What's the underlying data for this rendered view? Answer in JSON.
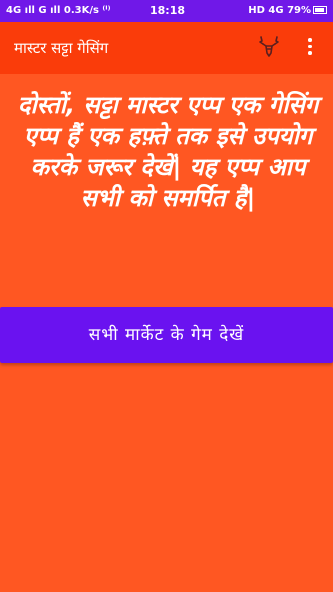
{
  "status_bar": {
    "left": "4G ıll G ıll 0.3K/s ⁽ᴵ⁾",
    "time": "18:18",
    "right": "HD 4G 79%"
  },
  "app_bar": {
    "title": "मास्टर सट्टा गेसिंग",
    "icon": "deer-head-icon",
    "menu_icon": "overflow-menu-icon"
  },
  "main": {
    "intro_text": "दोस्तों, सट्टा मास्टर एप्प एक गेसिंग एप्प हैं एक हफ़्ते तक इसे उपयोग करके जरूर देखें| यह एप्प आप सभी को समर्पित है|",
    "button_label": "सभी मार्केट के गेम देखें"
  },
  "colors": {
    "background": "#ff5722",
    "app_bar": "#fa3c0a",
    "status_bar": "#7018e8",
    "button": "#6a12f0",
    "text": "#ffffff"
  }
}
